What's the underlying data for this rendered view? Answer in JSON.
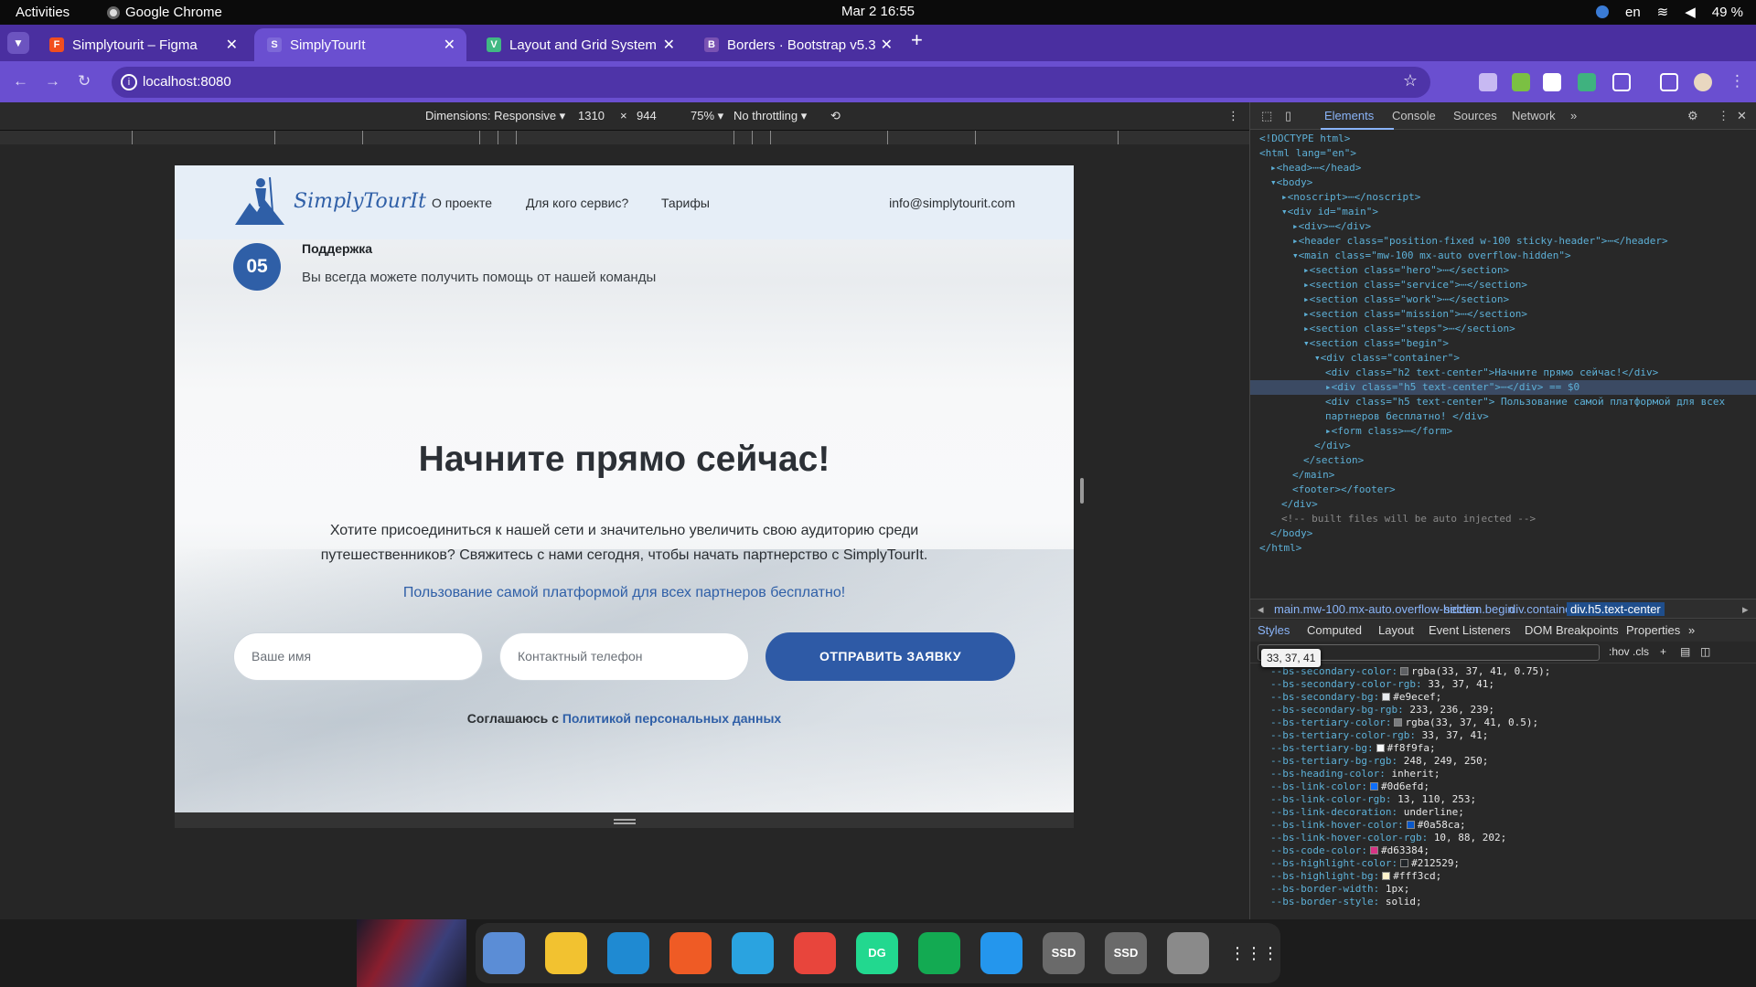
{
  "system_bar": {
    "activities": "Activities",
    "app": "Google Chrome",
    "clock": "Mar 2  16:55",
    "lang": "en",
    "battery": "49 %"
  },
  "tabs": [
    {
      "title": "Simplytourit – Figma",
      "favicon_color": "#f24e1e",
      "favicon": "F"
    },
    {
      "title": "SimplyTourIt",
      "favicon_color": "#6a4fd0",
      "favicon": "S"
    },
    {
      "title": "Layout and Grid System",
      "favicon_color": "#41b883",
      "favicon": "V"
    },
    {
      "title": "Borders · Bootstrap v5.3",
      "favicon_color": "#7952b3",
      "favicon": "B"
    }
  ],
  "address": {
    "url": "localhost:8080"
  },
  "device_toolbar": {
    "dimensions": "Dimensions: Responsive ▾",
    "width": "1310",
    "times": "×",
    "height": "944",
    "zoom": "75% ▾",
    "throttle": "No throttling ▾"
  },
  "site": {
    "logo": "SimplyTourIt",
    "nav": [
      "О проекте",
      "Для кого сервис?",
      "Тарифы"
    ],
    "email": "info@simplytourit.com",
    "step": {
      "num": "05",
      "title": "Поддержка",
      "desc": "Вы всегда можете получить помощь от нашей команды"
    },
    "heading": "Начните прямо сейчас!",
    "lead_line1": "Хотите присоединиться к нашей сети и значительно увеличить свою аудиторию среди",
    "lead_line2": "путешественников? Свяжитесь с нами сегодня, чтобы начать партнерство с SimplyTourIt.",
    "free": "Пользование самой платформой для всех партнеров бесплатно!",
    "name_placeholder": "Ваше имя",
    "phone_placeholder": "Контактный телефон",
    "submit": "ОТПРАВИТЬ ЗАЯВКУ",
    "agree_prefix": "Соглашаюсь с ",
    "agree_link": "Политикой персональных данных"
  },
  "devtools": {
    "tabs": [
      "Elements",
      "Console",
      "Sources",
      "Network",
      "»"
    ],
    "dom": [
      {
        "indent": 0,
        "html": "<!DOCTYPE html>"
      },
      {
        "indent": 0,
        "html": "<html lang=\"en\">"
      },
      {
        "indent": 1,
        "html": "▸<head>⋯</head>"
      },
      {
        "indent": 1,
        "html": "▾<body>"
      },
      {
        "indent": 2,
        "html": "▸<noscript>⋯</noscript>"
      },
      {
        "indent": 2,
        "html": "▾<div id=\"main\">"
      },
      {
        "indent": 3,
        "html": "▸<div>⋯</div>"
      },
      {
        "indent": 3,
        "html": "▸<header class=\"position-fixed w-100 sticky-header\">⋯</header>"
      },
      {
        "indent": 3,
        "html": "▾<main class=\"mw-100 mx-auto overflow-hidden\">"
      },
      {
        "indent": 4,
        "html": "▸<section class=\"hero\">⋯</section>"
      },
      {
        "indent": 4,
        "html": "▸<section class=\"service\">⋯</section>"
      },
      {
        "indent": 4,
        "html": "▸<section class=\"work\">⋯</section>"
      },
      {
        "indent": 4,
        "html": "▸<section class=\"mission\">⋯</section>"
      },
      {
        "indent": 4,
        "html": "▸<section class=\"steps\">⋯</section>"
      },
      {
        "indent": 4,
        "html": "▾<section class=\"begin\">"
      },
      {
        "indent": 5,
        "html": "▾<div class=\"container\">"
      },
      {
        "indent": 6,
        "html": "<div class=\"h2 text-center\">Начните прямо сейчас!</div>"
      },
      {
        "indent": 6,
        "html": "▸<div class=\"h5 text-center\">⋯</div> == $0",
        "selected": true
      },
      {
        "indent": 6,
        "html": "<div class=\"h5 text-center\"> Пользование самой платформой для всех"
      },
      {
        "indent": 6,
        "html": "партнеров бесплатно! </div>"
      },
      {
        "indent": 6,
        "html": "▸<form class>⋯</form>"
      },
      {
        "indent": 5,
        "html": "</div>"
      },
      {
        "indent": 4,
        "html": "</section>"
      },
      {
        "indent": 3,
        "html": "</main>"
      },
      {
        "indent": 3,
        "html": "<footer></footer>"
      },
      {
        "indent": 2,
        "html": "</div>"
      },
      {
        "indent": 2,
        "html": "<!-- built files will be auto injected -->"
      },
      {
        "indent": 1,
        "html": "</body>"
      },
      {
        "indent": 0,
        "html": "</html>"
      }
    ],
    "breadcrumbs": [
      "main.mw-100.mx-auto.overflow-hidden",
      "section.begin",
      "div.container",
      "div.h5.text-center"
    ],
    "panel_tabs": [
      "Styles",
      "Computed",
      "Layout",
      "Event Listeners",
      "DOM Breakpoints",
      "Properties",
      "»"
    ],
    "filter_tools": [
      ":hov",
      ".cls",
      "+"
    ],
    "tooltip": "33, 37, 41",
    "css_vars": [
      {
        "name": "--bs-secondary-color",
        "value": "rgba(33, 37, 41, 0.75);",
        "swatch": "#5e6063"
      },
      {
        "name": "--bs-secondary-color-rgb",
        "value": "33, 37, 41;"
      },
      {
        "name": "--bs-secondary-bg",
        "value": "#e9ecef;",
        "swatch": "#e9ecef"
      },
      {
        "name": "--bs-secondary-bg-rgb",
        "value": "233, 236, 239;"
      },
      {
        "name": "--bs-tertiary-color",
        "value": "rgba(33, 37, 41, 0.5);",
        "swatch": "#7a7c7e"
      },
      {
        "name": "--bs-tertiary-color-rgb",
        "value": "33, 37, 41;"
      },
      {
        "name": "--bs-tertiary-bg",
        "value": "#f8f9fa;",
        "swatch": "#f8f9fa"
      },
      {
        "name": "--bs-tertiary-bg-rgb",
        "value": "248, 249, 250;"
      },
      {
        "name": "--bs-heading-color",
        "value": "inherit;"
      },
      {
        "name": "--bs-link-color",
        "value": "#0d6efd;",
        "swatch": "#0d6efd"
      },
      {
        "name": "--bs-link-color-rgb",
        "value": "13, 110, 253;"
      },
      {
        "name": "--bs-link-decoration",
        "value": "underline;"
      },
      {
        "name": "--bs-link-hover-color",
        "value": "#0a58ca;",
        "swatch": "#0a58ca"
      },
      {
        "name": "--bs-link-hover-color-rgb",
        "value": "10, 88, 202;"
      },
      {
        "name": "--bs-code-color",
        "value": "#d63384;",
        "swatch": "#d63384"
      },
      {
        "name": "--bs-highlight-color",
        "value": "#212529;",
        "swatch": "#212529"
      },
      {
        "name": "--bs-highlight-bg",
        "value": "#fff3cd;",
        "swatch": "#fff3cd"
      },
      {
        "name": "--bs-border-width",
        "value": "1px;"
      },
      {
        "name": "--bs-border-style",
        "value": "solid;"
      }
    ]
  },
  "dock": [
    {
      "name": "files-icon",
      "color": "#5b8dd6"
    },
    {
      "name": "rhythmbox-icon",
      "color": "#f2c230"
    },
    {
      "name": "vscode-icon",
      "color": "#1f8ad2"
    },
    {
      "name": "postman-icon",
      "color": "#ef5b25"
    },
    {
      "name": "telegram-icon",
      "color": "#2aa3e0"
    },
    {
      "name": "chrome-icon",
      "color": "#e8453c"
    },
    {
      "name": "datagrip-icon",
      "color": "#22d88f",
      "label": "DG"
    },
    {
      "name": "mongodb-icon",
      "color": "#13aa52"
    },
    {
      "name": "docker-icon",
      "color": "#2496ed"
    },
    {
      "name": "ssd-drive-icon",
      "color": "#6a6a6a",
      "label": "SSD"
    },
    {
      "name": "ssd-drive-icon",
      "color": "#6a6a6a",
      "label": "SSD"
    },
    {
      "name": "trash-icon",
      "color": "#8a8a8a"
    },
    {
      "name": "app-grid-icon",
      "color": "#2a2a2a"
    }
  ]
}
